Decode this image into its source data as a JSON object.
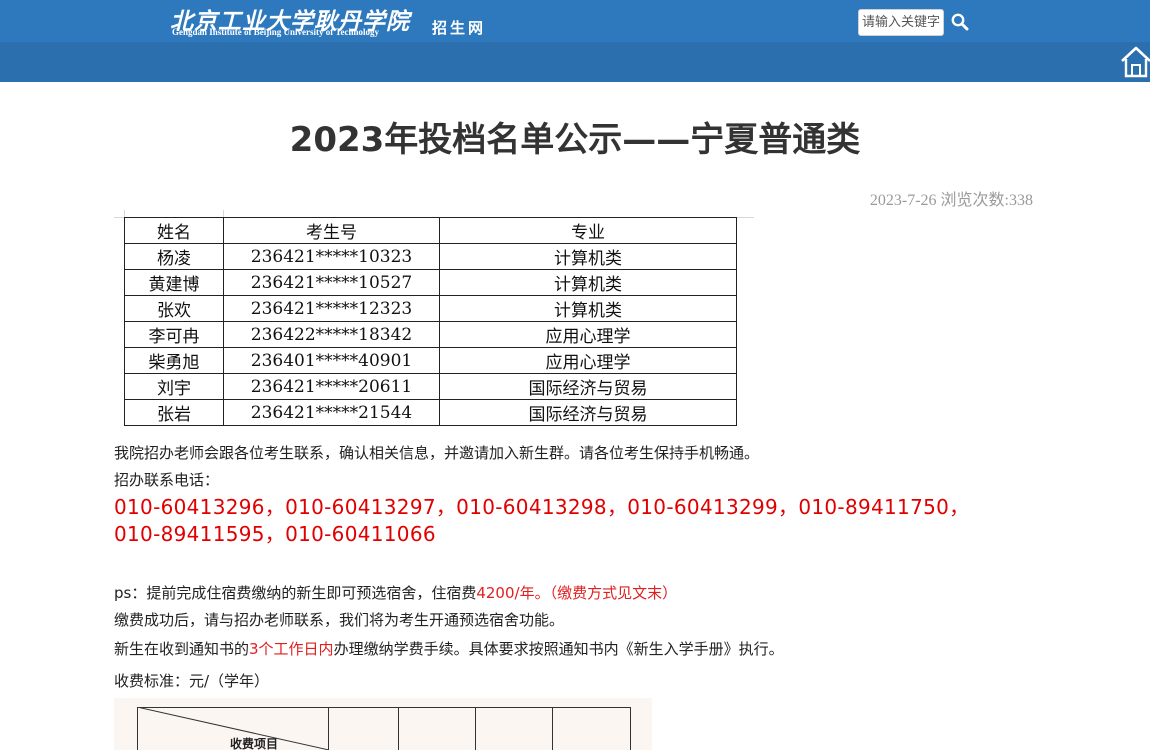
{
  "header": {
    "logo_cn": "北京工业大学耿丹学院",
    "logo_en": "Gengdan Institute of Beijing University of Technology",
    "logo_sub": "招生网",
    "search_placeholder": "请输入关键字",
    "colors": {
      "header_top": "#2e79bd",
      "header_band": "#2b6fae"
    }
  },
  "article": {
    "title": "2023年投档名单公示——宁夏普通类",
    "meta": "2023-7-26 浏览次数:338",
    "table": {
      "headers": [
        "姓名",
        "考生号",
        "专业"
      ],
      "rows": [
        [
          "杨凌",
          "236421*****10323",
          "计算机类"
        ],
        [
          "黄建博",
          "236421*****10527",
          "计算机类"
        ],
        [
          "张欢",
          "236421*****12323",
          "计算机类"
        ],
        [
          "李可冉",
          "236422*****18342",
          "应用心理学"
        ],
        [
          "柴勇旭",
          "236401*****40901",
          "应用心理学"
        ],
        [
          "刘宇",
          "236421*****20611",
          "国际经济与贸易"
        ],
        [
          "张岩",
          "236421*****21544",
          "国际经济与贸易"
        ]
      ]
    },
    "para1": "我院招办老师会跟各位考生联系，确认相关信息，并邀请加入新生群。请各位考生保持手机畅通。",
    "contact_label": "招办联系电话：",
    "phones": "010-60413296，010-60413297，010-60413298，010-60413299，010-89411750，010-89411595，010-60411066",
    "ps_prefix": "ps：提前完成住宿费缴纳的新生即可预选宿舍，住宿费",
    "ps_red": "4200/年。（缴费方式见文末）",
    "para_after_pay": "缴费成功后，请与招办老师联系，我们将为考生开通预选宿舍功能。",
    "notice_prefix": "新生在收到通知书的",
    "notice_red": "3个工作日内",
    "notice_suffix": "办理缴纳学费手续。具体要求按照通知书内《新生入学手册》执行。",
    "fee_standard": "收费标准：元/（学年）",
    "fee_table_label": "收费项目"
  }
}
